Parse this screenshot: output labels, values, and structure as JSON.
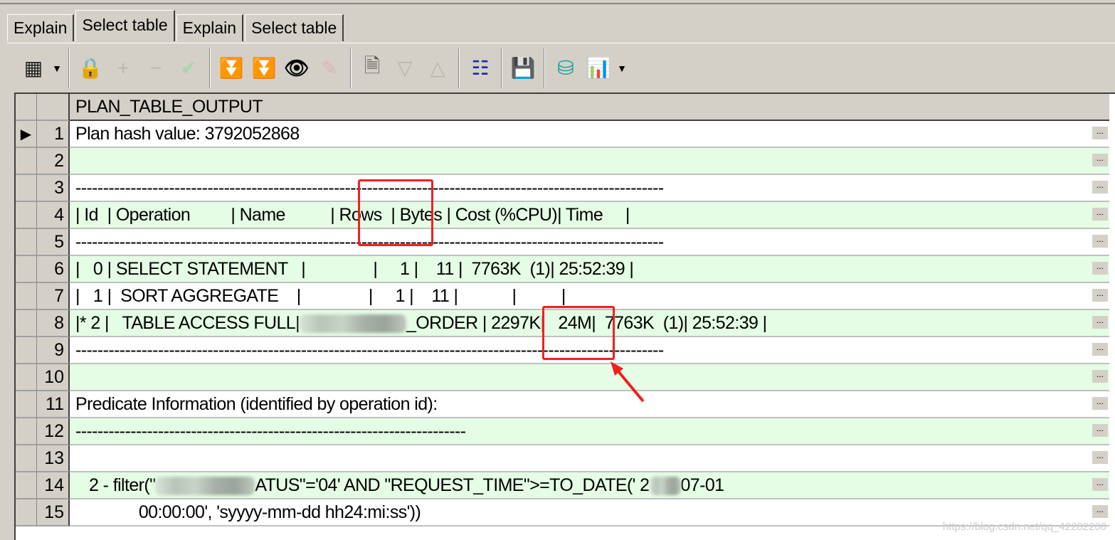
{
  "tabs": [
    {
      "label": "Explain",
      "active": false
    },
    {
      "label": "Select table",
      "active": true
    },
    {
      "label": "Explain",
      "active": false
    },
    {
      "label": "Select table",
      "active": false
    }
  ],
  "toolbar": [
    "grid-layout-icon",
    "dropdown-arrow-icon",
    "lock-icon",
    "plus-icon",
    "minus-icon",
    "checkmark-icon",
    "filter-down-icon",
    "filter-clear-icon",
    "binoculars-icon",
    "eraser-icon",
    "query-docs-icon",
    "sort-desc-icon",
    "sort-asc-icon",
    "tree-icon",
    "save-icon",
    "database-export-icon",
    "bar-chart-icon",
    "dropdown-arrow-icon"
  ],
  "grid": {
    "column_header": "PLAN_TABLE_OUTPUT",
    "ellipsis_label": "...",
    "rows": [
      {
        "n": "1",
        "text": "Plan hash value: 3792052868"
      },
      {
        "n": "2",
        "text": ""
      },
      {
        "n": "3",
        "text": "-----------------------------------------------------------------------------------------------------------"
      },
      {
        "n": "4",
        "text": "| Id  | Operation         | Name          | Rows  | Bytes | Cost (%CPU)| Time     |"
      },
      {
        "n": "5",
        "text": "-----------------------------------------------------------------------------------------------------------"
      },
      {
        "n": "6",
        "text": "|   0 | SELECT STATEMENT   |               |     1 |    11 |  7763K  (1)| 25:52:39 |"
      },
      {
        "n": "7",
        "text": "|   1 |  SORT AGGREGATE    |               |     1 |    11 |            |          |"
      },
      {
        "n": "8",
        "text_pre": "|* 2 |   TABLE ACCESS FULL|",
        "text_post": "_ORDER | 2297K|   24M|  7763K  (1)| 25:52:39 |"
      },
      {
        "n": "9",
        "text": "-----------------------------------------------------------------------------------------------------------"
      },
      {
        "n": "10",
        "text": ""
      },
      {
        "n": "11",
        "text": "Predicate Information (identified by operation id):"
      },
      {
        "n": "12",
        "text": "-----------------------------------------------------------------------"
      },
      {
        "n": "13",
        "text": ""
      },
      {
        "n": "14",
        "text_pre": "   2 - filter(\"",
        "text_mid": "ATUS\"='04' AND \"REQUEST_TIME\">=TO_DATE(' 2",
        "text_post": "07-01"
      },
      {
        "n": "15",
        "text": "              00:00:00', 'syyyy-mm-dd hh24:mi:ss'))"
      }
    ]
  },
  "watermark": "https://blog.csdn.net/qq_42282200",
  "colors": {
    "alt_row": "#e4fde4",
    "highlight": "#f02020",
    "chrome": "#d4d0c8"
  }
}
